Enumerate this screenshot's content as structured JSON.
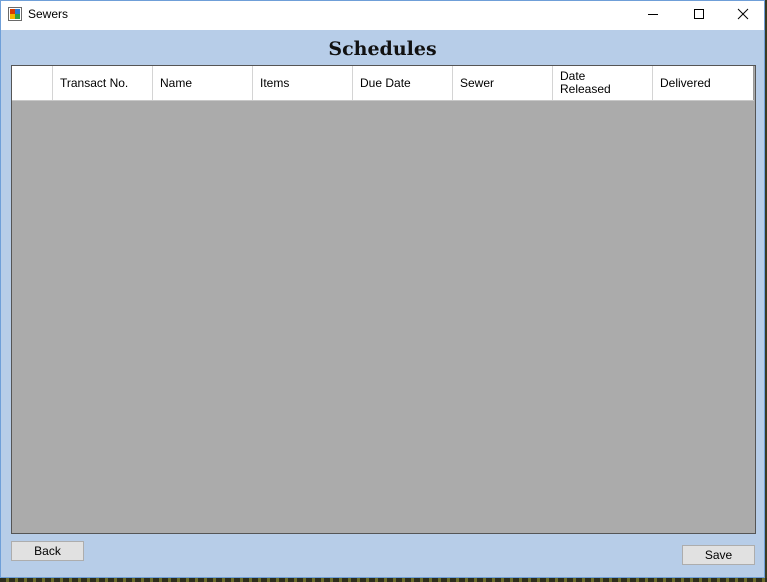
{
  "window": {
    "title": "Sewers"
  },
  "header": {
    "title": "Schedules"
  },
  "table": {
    "columns": [
      "Transact No.",
      "Name",
      "Items",
      "Due Date",
      "Sewer",
      "Date Released",
      "Delivered"
    ],
    "rows": []
  },
  "buttons": {
    "back_label": "Back",
    "save_label": "Save"
  },
  "colors": {
    "form_background": "#b7cde8",
    "grid_background": "#ababab"
  },
  "icons": [
    "app-icon",
    "minimize-icon",
    "maximize-icon",
    "close-icon"
  ]
}
